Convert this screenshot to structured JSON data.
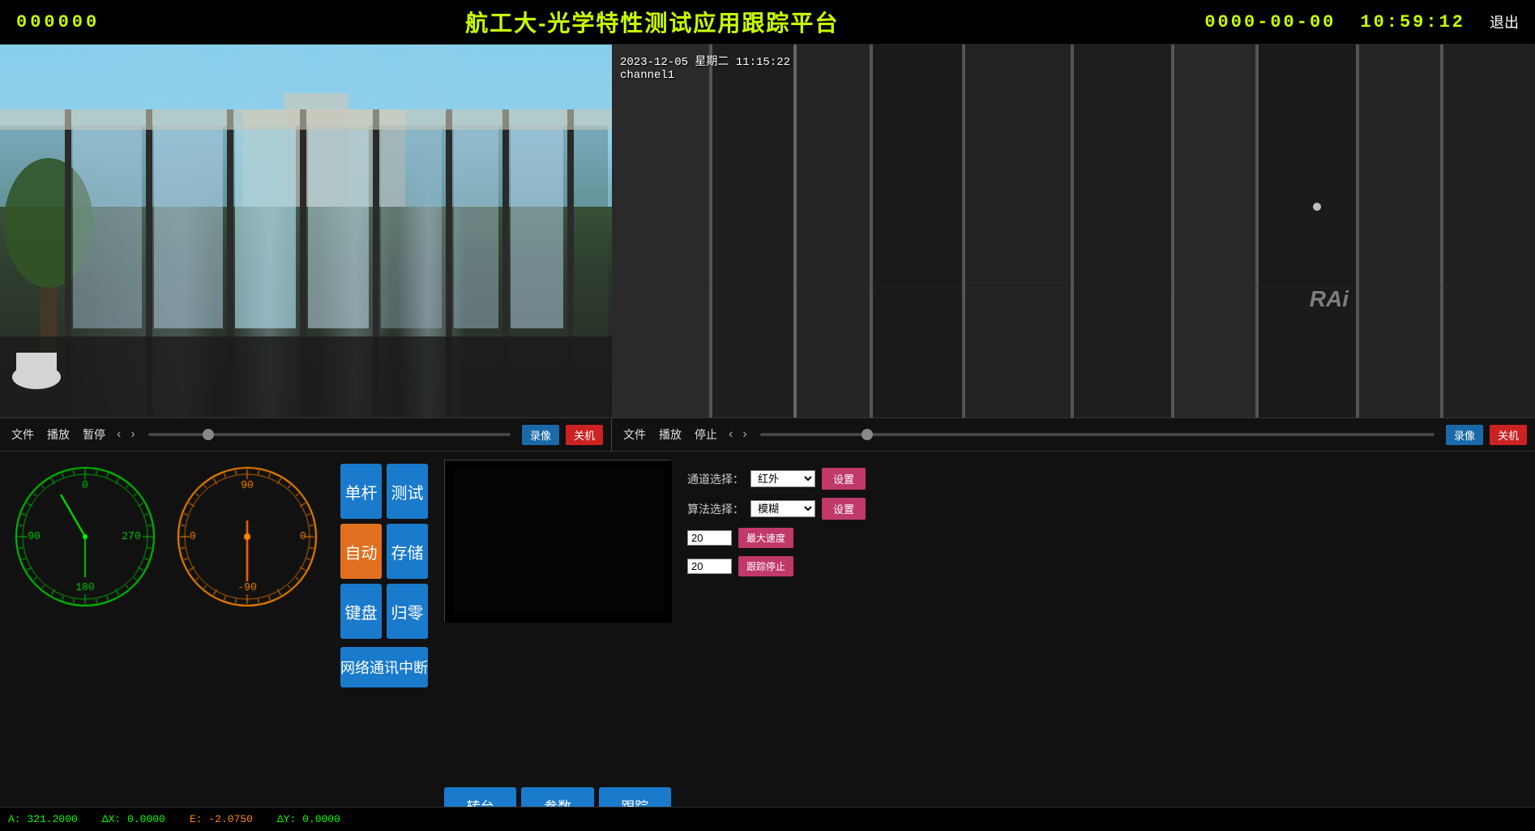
{
  "header": {
    "led_left": "000000",
    "title": "航工大-光学特性测试应用跟踪平台",
    "led_right": "0000-00-00",
    "time_right": "10:59:12",
    "exit_label": "退出"
  },
  "video_left": {
    "overlay_date": "",
    "overlay_channel": ""
  },
  "video_right": {
    "overlay_date": "2023-12-05  星期二  11:15:22",
    "overlay_channel": "channel1"
  },
  "control_bar_left": {
    "file_btn": "文件",
    "play_btn": "播放",
    "pause_btn": "暂停",
    "prev_btn": "‹",
    "next_btn": "›",
    "record_btn": "录像",
    "off_btn": "关机"
  },
  "control_bar_right": {
    "file_btn": "文件",
    "play_btn": "播放",
    "stop_btn": "停止",
    "prev_btn": "‹",
    "next_btn": "›",
    "record_btn": "录像",
    "off_btn": "关机"
  },
  "control_buttons": {
    "single_pole": "单杆",
    "test": "测试",
    "auto": "自动",
    "store": "存储",
    "keyboard": "键盘",
    "zero": "归零",
    "network_interrupt": "网络通讯中断"
  },
  "tracking_panel": {
    "channel_label": "通道选择：",
    "channel_value": "红外",
    "algo_label": "算法选择：",
    "algo_value": "模糊",
    "set_btn1": "设置",
    "set_btn2": "设置",
    "input1_value": "20",
    "input2_value": "20",
    "max_speed_btn": "最大速度",
    "track_stop_btn": "跟踪停止",
    "bottom_btn1": "转台",
    "bottom_btn2": "参数",
    "bottom_btn3": "跟踪"
  },
  "rai_label": "RAi",
  "status_bar": {
    "a_label": "A:",
    "a_value": "321.2000",
    "ax_label": "ΔX:",
    "ax_value": "0.0000",
    "e_label": "E:",
    "e_value": "-2.0750",
    "ay_label": "ΔY:",
    "ay_value": "0.0000"
  },
  "gauge_left": {
    "label": "compass"
  },
  "gauge_right": {
    "label": "meter"
  }
}
